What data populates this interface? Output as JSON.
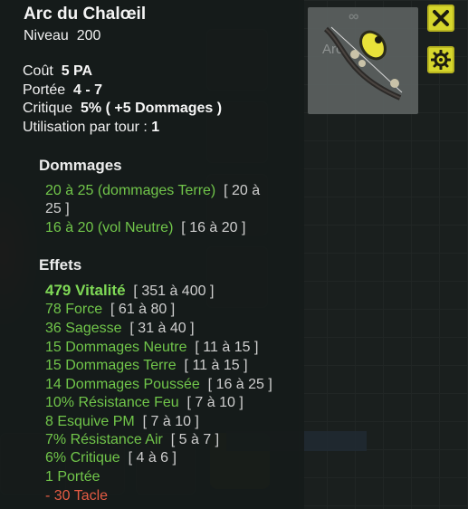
{
  "item": {
    "name": "Arc du Chalœil",
    "level_label": "Niveau",
    "level": "200",
    "category": "Arc"
  },
  "stats": {
    "cost_label": "Coût",
    "cost_value": "5 PA",
    "range_label": "Portée",
    "range_value": "4 - 7",
    "crit_label": "Critique",
    "crit_value": "5% ( +5 Dommages )",
    "uses_label": "Utilisation par tour :",
    "uses_value": "1"
  },
  "damage": {
    "heading": "Dommages",
    "lines": [
      {
        "main": "20 à 25 (dommages Terre)",
        "range": "[ 20 à",
        "range_wrap": "25 ]"
      },
      {
        "main": "16 à 20 (vol Neutre)",
        "range": "[ 16 à 20 ]"
      }
    ]
  },
  "effects": {
    "heading": "Effets",
    "lines": [
      {
        "main": "479 Vitalité",
        "range": "[ 351 à 400 ]"
      },
      {
        "main": "78 Force",
        "range": "[ 61 à 80 ]"
      },
      {
        "main": "36 Sagesse",
        "range": "[ 31 à 40 ]"
      },
      {
        "main": "15 Dommages Neutre",
        "range": "[ 11 à 15 ]"
      },
      {
        "main": "15 Dommages Terre",
        "range": "[ 11 à 15 ]"
      },
      {
        "main": "14 Dommages Poussée",
        "range": "[ 16 à 25 ]"
      },
      {
        "main": "10% Résistance Feu",
        "range": "[ 7 à 10 ]"
      },
      {
        "main": "8 Esquive PM",
        "range": "[ 7 à 10 ]"
      },
      {
        "main": "7% Résistance Air",
        "range": "[ 5 à 7 ]"
      },
      {
        "main": "6% Critique",
        "range": "[ 4 à 6 ]"
      },
      {
        "main": "1 Portée",
        "range": ""
      },
      {
        "main": "- 30 Tacle",
        "range": ""
      }
    ]
  },
  "buttons": {
    "close_icon": "close-icon",
    "settings_icon": "gear-icon"
  },
  "colors": {
    "bonus_green": "#71c64a",
    "malus_red": "#e45b43",
    "button_yellow": "#d6d62c"
  }
}
